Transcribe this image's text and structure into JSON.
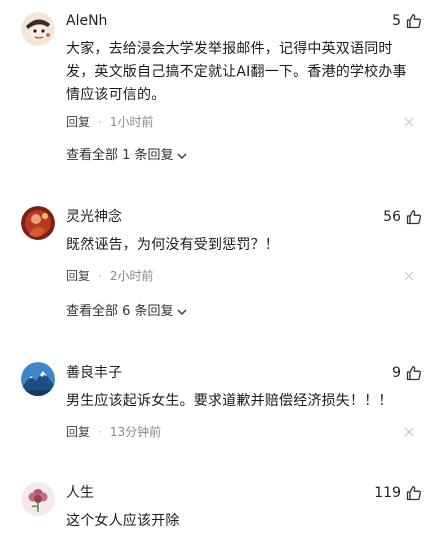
{
  "comments": [
    {
      "username": "AleNh",
      "likes": "5",
      "content": "大家，去给浸会大学发举报邮件，记得中英双语同时发，英文版自己搞不定就让AI翻一下。香港的学校办事情应该可信的。",
      "reply_label": "回复",
      "time": "1小时前",
      "view_all_replies": "查看全部 1 条回复",
      "avatar_icon": "cartoon-face-icon"
    },
    {
      "username": "灵光神念",
      "likes": "56",
      "content": "既然诬告，为何没有受到惩罚？！",
      "reply_label": "回复",
      "time": "2小时前",
      "view_all_replies": "查看全部 6 条回复",
      "avatar_icon": "red-figure-icon"
    },
    {
      "username": "善良丰子",
      "likes": "9",
      "content": "男生应该起诉女生。要求道歉并赔偿经济损失！！！",
      "reply_label": "回复",
      "time": "13分钟前",
      "avatar_icon": "mountain-icon"
    },
    {
      "username": "人生",
      "likes": "119",
      "content": "这个女人应该开除",
      "avatar_icon": "flower-icon"
    }
  ],
  "colors": {
    "text": "#222222",
    "muted": "#8a8a8a",
    "background": "#ffffff"
  }
}
